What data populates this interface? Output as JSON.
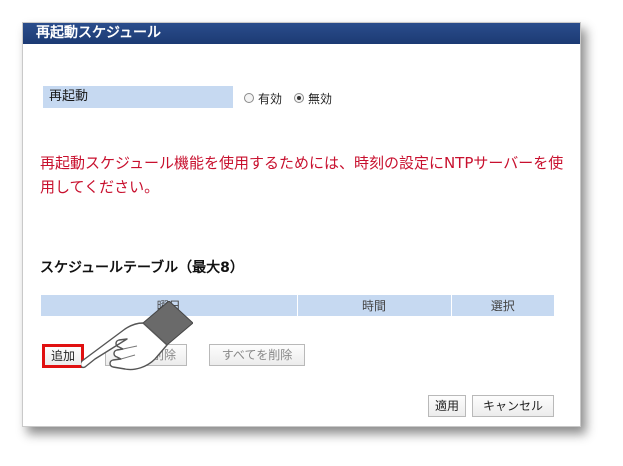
{
  "panel": {
    "title": "再起動スケジュール"
  },
  "reboot_setting": {
    "label": "再起動",
    "options": [
      "有効",
      "無効"
    ],
    "selected": "無効"
  },
  "warning_text": "再起動スケジュール機能を使用するためには、時刻の設定にNTPサーバーを使用してください。",
  "schedule_table": {
    "title": "スケジュールテーブル（最大8）",
    "columns": [
      "曜日",
      "時間",
      "選択"
    ]
  },
  "buttons": {
    "add": "追加",
    "delete_selected": "選択を削除",
    "delete_all": "すべてを削除",
    "apply": "適用",
    "cancel": "キャンセル"
  },
  "colors": {
    "header_bg": "#1c3a73",
    "label_bg": "#c6d9f1",
    "warning_text": "#c8102e",
    "highlight_border": "#e01010"
  },
  "icons": {
    "pointer": "hand-pointer-icon"
  }
}
